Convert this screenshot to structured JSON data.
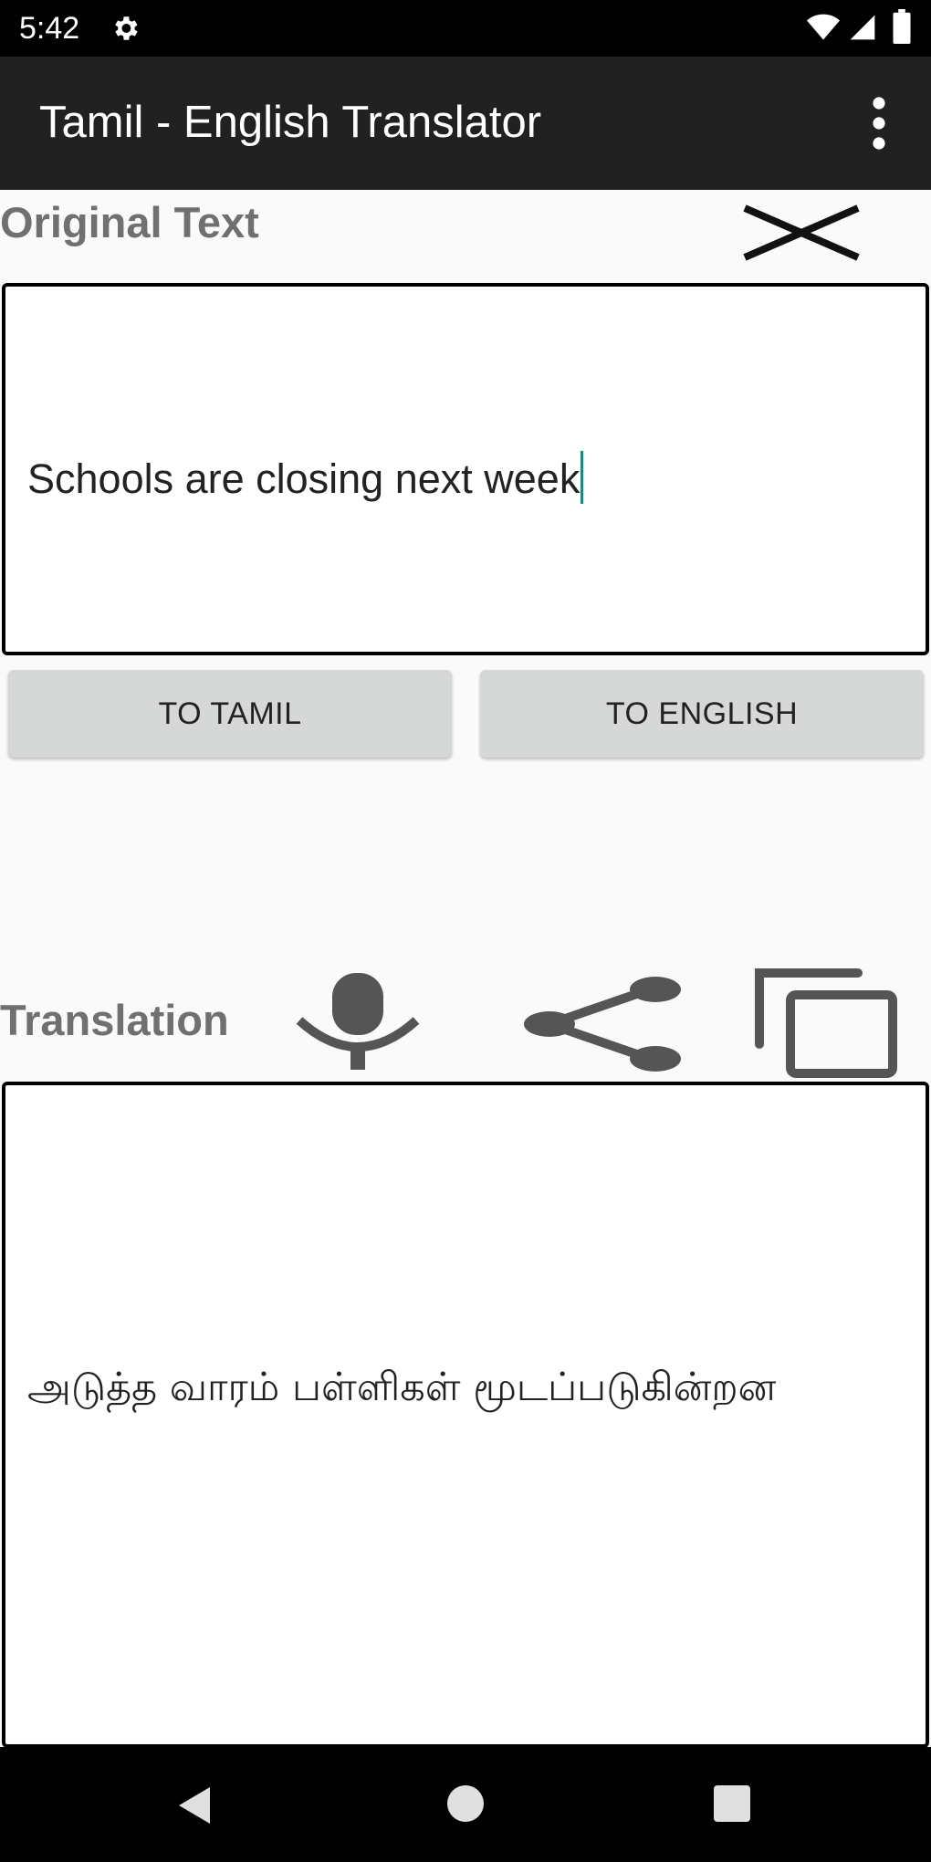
{
  "status_bar": {
    "time": "5:42",
    "icons": [
      "gear-icon",
      "wifi-icon",
      "signal-icon",
      "battery-icon"
    ]
  },
  "app_bar": {
    "title": "Tamil - English Translator",
    "menu_icon": "more-vert-icon"
  },
  "original": {
    "label": "Original Text",
    "clear_icon": "close-icon",
    "text": "Schools are closing next week"
  },
  "buttons": {
    "to_tamil": "TO TAMIL",
    "to_english": "TO ENGLISH"
  },
  "translation": {
    "label": "Translation",
    "icons": [
      "microphone-icon",
      "share-icon",
      "copy-icon"
    ],
    "text": "அடுத்த வாரம் பள்ளிகள் மூடப்படுகின்றன"
  },
  "nav_bar": {
    "icons": [
      "back-icon",
      "home-icon",
      "recents-icon"
    ]
  },
  "colors": {
    "app_bar": "#212121",
    "background": "#fafafa",
    "label": "#707070",
    "button": "#d6d7d7",
    "cursor": "#1e8a7a"
  }
}
